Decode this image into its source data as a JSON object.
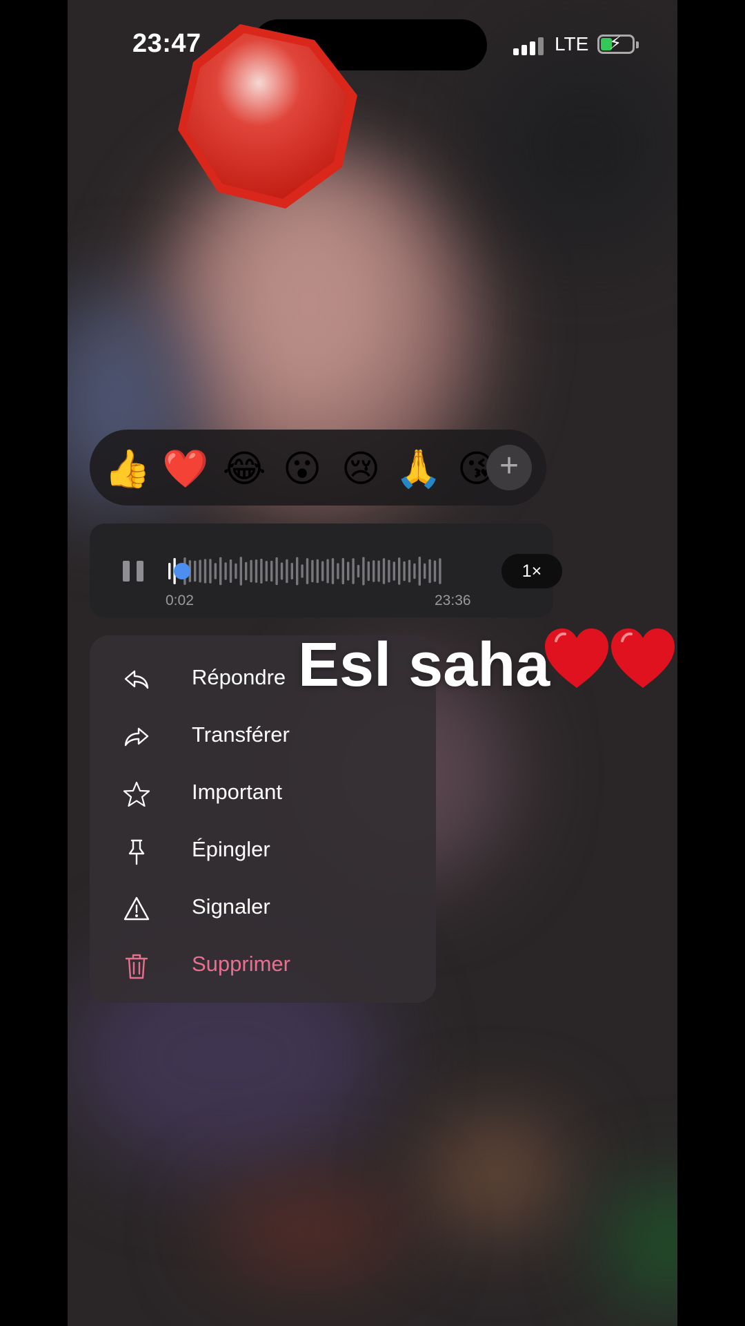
{
  "status_bar": {
    "time": "23:47",
    "network": "LTE",
    "battery_charging": true
  },
  "sticker": {
    "icon": "stop-octagon-sticker",
    "color": "#d9271b"
  },
  "reactions": {
    "emojis": [
      {
        "name": "thumbs-up",
        "glyph": "👍"
      },
      {
        "name": "red-heart",
        "glyph": "❤️"
      },
      {
        "name": "tears-of-joy",
        "glyph": "😂"
      },
      {
        "name": "surprised",
        "glyph": "😮"
      },
      {
        "name": "crying",
        "glyph": "😢"
      },
      {
        "name": "folded-hands",
        "glyph": "🙏"
      },
      {
        "name": "face-blowing-kiss",
        "glyph": "😘"
      }
    ],
    "more_icon": "plus-icon",
    "more_label": "+"
  },
  "voice_message": {
    "elapsed": "0:02",
    "duration": "23:36",
    "speed": "1×",
    "progress": 0.0014,
    "accent_color": "#4d8ff0"
  },
  "context_menu": {
    "items": [
      {
        "label": "Répondre",
        "icon": "reply-icon"
      },
      {
        "label": "Transférer",
        "icon": "forward-icon"
      },
      {
        "label": "Important",
        "icon": "star-icon"
      },
      {
        "label": "Épingler",
        "icon": "pin-icon"
      },
      {
        "label": "Signaler",
        "icon": "warning-icon"
      },
      {
        "label": "Supprimer",
        "icon": "trash-icon",
        "color": "#e8708f"
      }
    ]
  },
  "overlay": {
    "caption": "Esl saha",
    "hearts": "❤️❤️"
  }
}
